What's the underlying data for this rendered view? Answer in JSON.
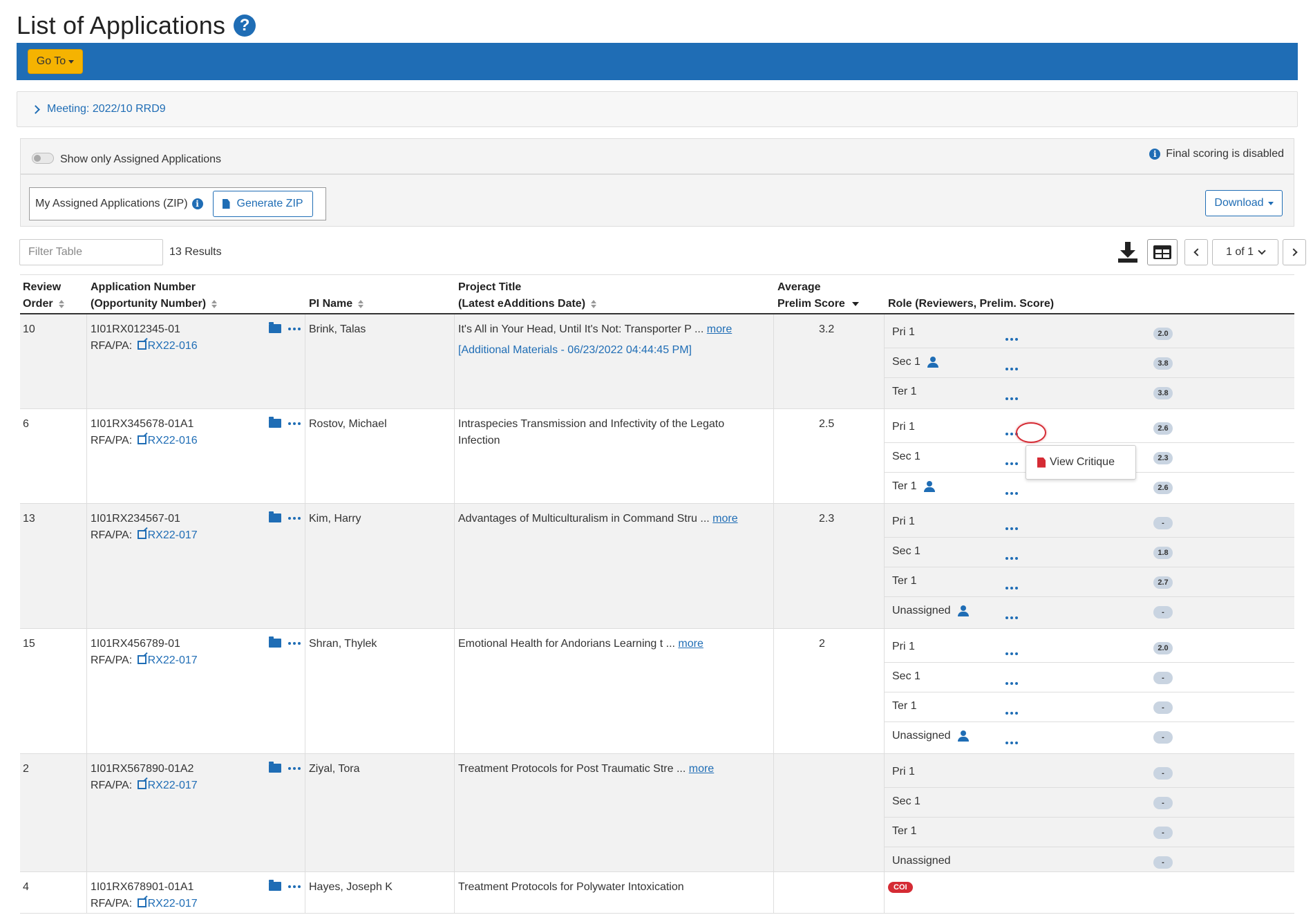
{
  "page": {
    "title": "List of Applications",
    "help_icon": "question-circle-icon"
  },
  "toolbar": {
    "goto_label": "Go To"
  },
  "meeting": {
    "label": "Meeting:",
    "value": "2022/10 RRD9"
  },
  "filters": {
    "toggle_label": "Show only Assigned Applications",
    "final_scoring_note": "Final scoring is disabled",
    "zip_label": "My Assigned Applications (ZIP)",
    "generate_zip_label": "Generate ZIP",
    "download_label": "Download"
  },
  "table_controls": {
    "filter_placeholder": "Filter Table",
    "results": "13 Results",
    "page_label": "1 of 1"
  },
  "headers": {
    "review_order_1": "Review",
    "review_order_2": "Order",
    "app_number_1": "Application Number",
    "app_number_2": "(Opportunity Number)",
    "pi_name": "PI Name",
    "project_title_1": "Project Title",
    "project_title_2": "(Latest eAdditions Date)",
    "avg_score_1": "Average",
    "avg_score_2": "Prelim Score",
    "role": "Role (Reviewers, Prelim. Score)"
  },
  "rows": [
    {
      "order": "10",
      "app": "1I01RX012345-01",
      "rfa_label": "RFA/PA:",
      "rfa": "RX22-016",
      "pi": "Brink, Talas",
      "title": "It's All in Your Head, Until It's Not: Transporter P",
      "title_suffix": " ... ",
      "more": "more",
      "additional": "[Additional Materials - 06/23/2022 04:44:45 PM]",
      "score": "3.2",
      "roles": [
        {
          "name": "Pri 1",
          "score": "2.0"
        },
        {
          "name": "Sec 1",
          "score": "3.8"
        },
        {
          "name": "Ter 1",
          "score": "3.8"
        }
      ]
    },
    {
      "order": "6",
      "app": "1I01RX345678-01A1",
      "rfa_label": "RFA/PA:",
      "rfa": "RX22-016",
      "pi": "Rostov, Michael",
      "title": "Intraspecies Transmission and Infectivity of the Legato",
      "title2": "Infection",
      "score": "2.5",
      "roles": [
        {
          "name": "Pri 1",
          "score": "2.6"
        },
        {
          "name": "Sec 1",
          "score": "2.3"
        },
        {
          "name": "Ter 1",
          "score": "2.6"
        }
      ]
    },
    {
      "order": "13",
      "app": "1I01RX234567-01",
      "rfa_label": "RFA/PA:",
      "rfa": "RX22-017",
      "pi": "Kim, Harry",
      "title": "Advantages of Multiculturalism in Command Stru",
      "title_suffix": " ... ",
      "more": "more",
      "score": "2.3",
      "roles": [
        {
          "name": "Pri 1",
          "score": "-"
        },
        {
          "name": "Sec 1",
          "score": "1.8"
        },
        {
          "name": "Ter 1",
          "score": "2.7"
        },
        {
          "name": "Unassigned",
          "score": "-"
        }
      ]
    },
    {
      "order": "15",
      "app": "1I01RX456789-01",
      "rfa_label": "RFA/PA:",
      "rfa": "RX22-017",
      "pi": "Shran, Thylek",
      "title": "Emotional Health for Andorians Learning t",
      "title_suffix": " ... ",
      "more": "more",
      "score": "2",
      "roles": [
        {
          "name": "Pri 1",
          "score": "2.0"
        },
        {
          "name": "Sec 1",
          "score": "-"
        },
        {
          "name": "Ter 1",
          "score": "-"
        },
        {
          "name": "Unassigned",
          "score": "-"
        }
      ]
    },
    {
      "order": "2",
      "app": "1I01RX567890-01A2",
      "rfa_label": "RFA/PA:",
      "rfa": "RX22-017",
      "pi": "Ziyal, Tora",
      "title": "Treatment Protocols for Post Traumatic Stre",
      "title_suffix": " ... ",
      "more": "more",
      "score": "",
      "roles": [
        {
          "name": "Pri 1",
          "score": "-"
        },
        {
          "name": "Sec 1",
          "score": "-"
        },
        {
          "name": "Ter 1",
          "score": "-"
        },
        {
          "name": "Unassigned",
          "score": "-"
        }
      ]
    },
    {
      "order": "4",
      "app": "1I01RX678901-01A1",
      "rfa_label": "RFA/PA:",
      "rfa": "RX22-017",
      "pi": "Hayes, Joseph K",
      "title": "Treatment Protocols for Polywater Intoxication",
      "score": "",
      "coi": "COI"
    }
  ],
  "popup": {
    "label": "View Critique"
  },
  "colors": {
    "primary": "#1f6db5",
    "accent": "#f5b301",
    "danger": "#d52b34"
  }
}
